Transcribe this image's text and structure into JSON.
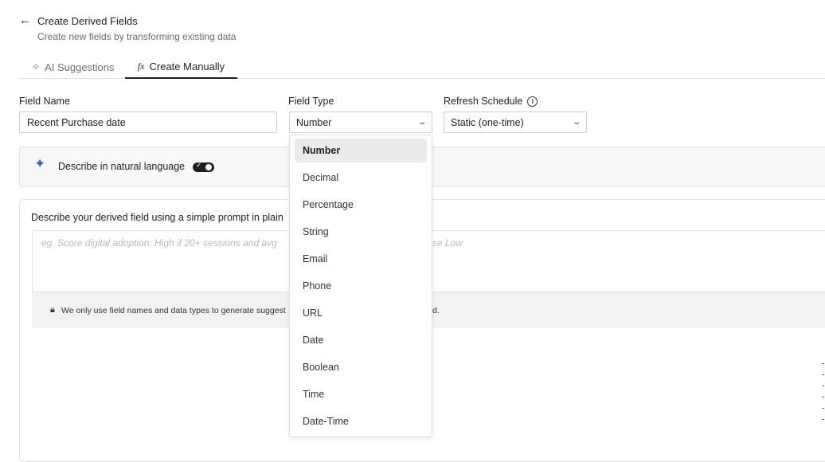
{
  "header": {
    "back_icon": "arrow-left-icon",
    "title": "Create Derived Fields",
    "subtitle": "Create new fields by transforming existing data"
  },
  "tabs": [
    {
      "label": "AI Suggestions",
      "icon": "sparkle-icon",
      "active": false
    },
    {
      "label": "Create Manually",
      "icon": "function-icon",
      "active": true
    }
  ],
  "form": {
    "field_name_label": "Field Name",
    "field_name_value": "Recent Purchase date",
    "field_type_label": "Field Type",
    "field_type_value": "Number",
    "refresh_label": "Refresh Schedule",
    "refresh_value": "Static (one-time)"
  },
  "natural_language": {
    "label": "Describe in natural language",
    "toggle_on": true
  },
  "prompt": {
    "heading": "Describe your derived field using a simple prompt in plain",
    "placeholder": "eg. Score digital adoption: High if 20+ sessions and avg",
    "placeholder_tail": "se Low",
    "privacy_text": "We only use field names and data types to generate suggest",
    "privacy_tail": "d."
  },
  "dropdown": {
    "options": [
      "Number",
      "Decimal",
      "Percentage",
      "String",
      "Email",
      "Phone",
      "URL",
      "Date",
      "Boolean",
      "Time",
      "Date-Time"
    ],
    "selected": "Number"
  },
  "colors": {
    "accent": "#3b63c9",
    "selected_bg": "#ebebeb",
    "panel_bg": "#f8f8f8"
  }
}
